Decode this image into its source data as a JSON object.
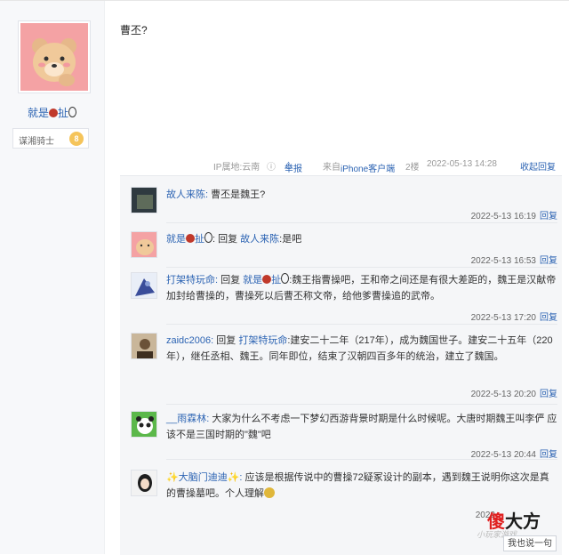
{
  "user": {
    "name": "就是",
    "name_suffix": "扯",
    "badge_label": "谋湘骑士",
    "badge_level": "8"
  },
  "post": {
    "text": "曹丕?"
  },
  "meta": {
    "ip": "IP属地:云南",
    "report": "举报",
    "source": "来自iPhone客户端",
    "floor": "2楼",
    "datetime": "2022-05-13 14:28",
    "collapse": "收起回复"
  },
  "replies": [
    {
      "user": "故人来陈:",
      "text": "曹丕是魏王?",
      "time": "2022-5-13 16:19",
      "reply_label": "回复"
    },
    {
      "user": "就是",
      "user_suffix": "扯",
      "mid": ": 回复 ",
      "target": "故人来陈",
      "text": ":是吧",
      "time": "2022-5-13 16:53",
      "reply_label": "回复"
    },
    {
      "user": "打架特玩命:",
      "mid": " 回复 ",
      "target": "就是",
      "target_suffix": "扯",
      "text": ":魏王指曹操吧，王和帝之间还是有很大差距的，魏王是汉献帝加封给曹操的，曹操死以后曹丕称文帝，给他爹曹操追的武帝。",
      "time": "2022-5-13 17:20",
      "reply_label": "回复"
    },
    {
      "user": "zaidc2006:",
      "mid": " 回复 ",
      "target": "打架特玩命",
      "text": ":建安二十二年（217年），成为魏国世子。建安二十五年（220年），继任丞相、魏王。同年即位，结束了汉朝四百多年的统治，建立了魏国。",
      "time": "2022-5-13 20:20",
      "reply_label": "回复"
    },
    {
      "user": "__雨霖林:",
      "text": " 大家为什么不考虑一下梦幻西游背景时期是什么时候呢。大唐时期魏王叫李俨 应该不是三国时期的\"魏\"吧",
      "time": "2022-5-13 20:44",
      "reply_label": "回复"
    },
    {
      "user": "✨大脑门迪迪✨:",
      "text": " 应该是根据传说中的曹操72疑冢设计的副本，遇到魏王说明你这次是真的曹操墓吧。个人理解",
      "time": "2022",
      "reply_label": ""
    }
  ],
  "say_button": "我也说一句",
  "watermark": {
    "char1": "傻",
    "char2": "大方",
    "sub": "小玩家游戏"
  }
}
